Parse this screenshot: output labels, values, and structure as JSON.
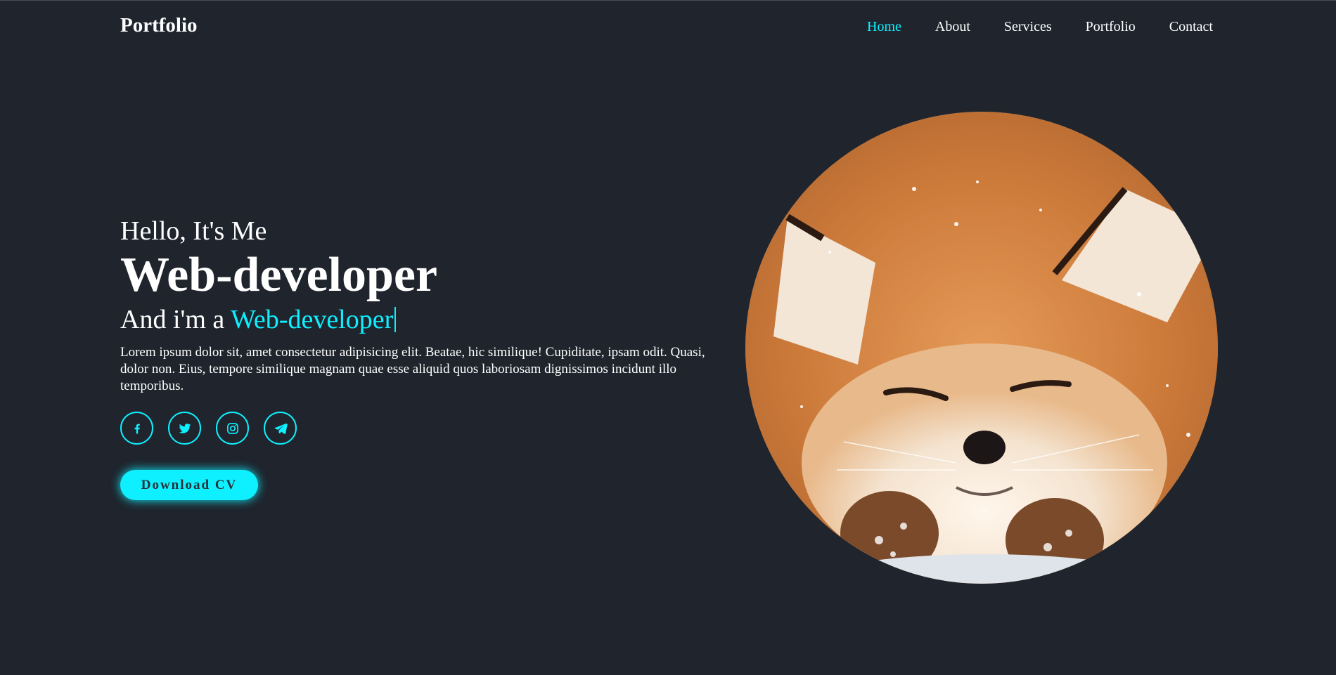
{
  "header": {
    "logo": "Portfolio",
    "nav": [
      {
        "label": "Home",
        "active": true
      },
      {
        "label": "About",
        "active": false
      },
      {
        "label": "Services",
        "active": false
      },
      {
        "label": "Portfolio",
        "active": false
      },
      {
        "label": "Contact",
        "active": false
      }
    ]
  },
  "hero": {
    "greeting": "Hello, It's Me",
    "title": "Web-developer",
    "role_prefix": "And i'm a",
    "role_accent": "Web-developer",
    "description": "Lorem ipsum dolor sit, amet consectetur adipisicing elit. Beatae, hic similique! Cupiditate, ipsam odit. Quasi, dolor non. Eius, tempore similique magnam quae esse aliquid quos laboriosam dignissimos incidunt illo temporibus.",
    "socials": [
      "facebook-icon",
      "twitter-icon",
      "instagram-icon",
      "telegram-icon"
    ],
    "cta_label": "Download CV",
    "image": "fox-portrait"
  },
  "colors": {
    "background": "#1f242d",
    "accent": "#0ef0ff",
    "text": "#ffffff"
  }
}
